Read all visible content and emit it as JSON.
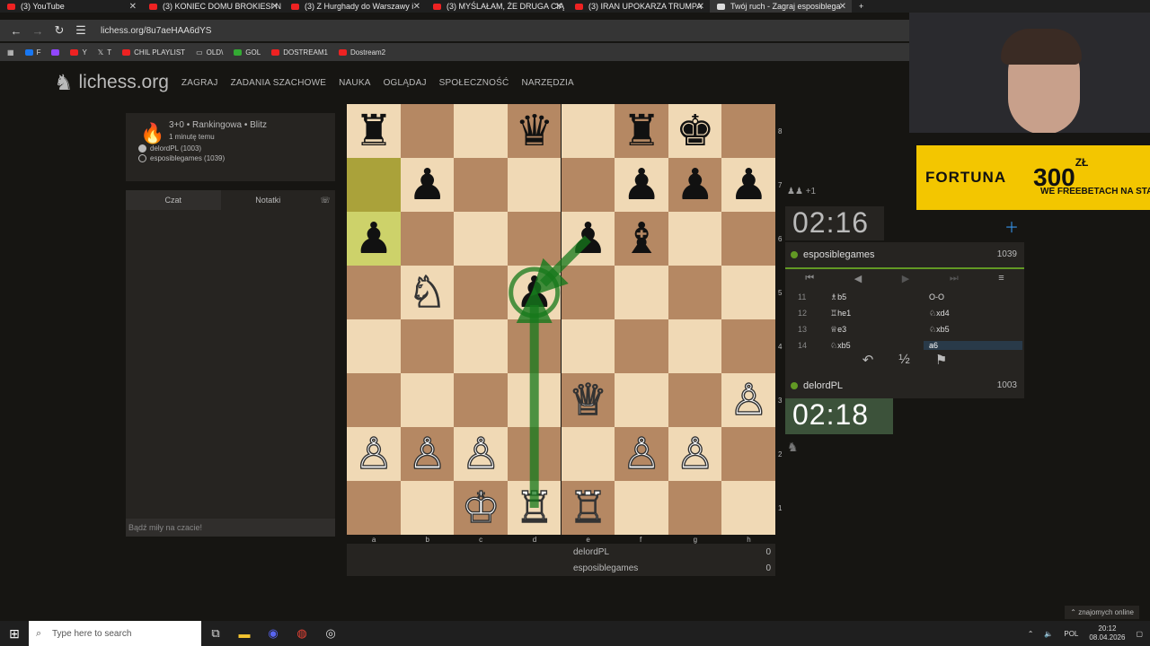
{
  "browser": {
    "tabs": [
      {
        "label": "(3) YouTube",
        "active": false
      },
      {
        "label": "(3) KONIEC DOMU BROKIESI N",
        "active": false
      },
      {
        "label": "(3) Z Hurghady do Warszawy i",
        "active": false
      },
      {
        "label": "(3) MYŚLAŁAM, ŻE DRUGA CIĄ",
        "active": false
      },
      {
        "label": "(3) IRAN UPOKARZA TRUMPA",
        "active": false
      },
      {
        "label": "Twój ruch - Zagraj esposiblega",
        "active": true
      }
    ],
    "url": "lichess.org/8u7aeHAA6dYS",
    "bookmarks": [
      "F",
      "Y",
      "T",
      "CHIL PLAYLIST",
      "OLD\\",
      "GOL",
      "DOSTREAM1",
      "Dostream2"
    ]
  },
  "lichess": {
    "logo": "lichess.org",
    "menu": [
      "ZAGRAJ",
      "ZADANIA SZACHOWE",
      "NAUKA",
      "OGLĄDAJ",
      "SPOŁECZNOŚĆ",
      "NARZĘDZIA"
    ]
  },
  "game_info": {
    "title": "3+0 • Rankingowa • Blitz",
    "time": "1 minutę temu",
    "white": "delordPL (1003)",
    "black": "esposiblegames (1039)"
  },
  "chat": {
    "tab_chat": "Czat",
    "tab_notes": "Notatki",
    "placeholder": "Bądź miły na czacie!"
  },
  "board": {
    "files": [
      "a",
      "b",
      "c",
      "d",
      "e",
      "f",
      "g",
      "h"
    ],
    "ranks": [
      "8",
      "7",
      "6",
      "5",
      "4",
      "3",
      "2",
      "1"
    ],
    "pieces": [
      {
        "sq": "a8",
        "p": "♜",
        "c": "b"
      },
      {
        "sq": "d8",
        "p": "♛",
        "c": "b"
      },
      {
        "sq": "f8",
        "p": "♜",
        "c": "b"
      },
      {
        "sq": "g8",
        "p": "♚",
        "c": "b"
      },
      {
        "sq": "b7",
        "p": "♟",
        "c": "b"
      },
      {
        "sq": "f7",
        "p": "♟",
        "c": "b"
      },
      {
        "sq": "g7",
        "p": "♟",
        "c": "b"
      },
      {
        "sq": "h7",
        "p": "♟",
        "c": "b"
      },
      {
        "sq": "a6",
        "p": "♟",
        "c": "b"
      },
      {
        "sq": "e6",
        "p": "♟",
        "c": "b"
      },
      {
        "sq": "f6",
        "p": "♝",
        "c": "b"
      },
      {
        "sq": "b5",
        "p": "♘",
        "c": "w"
      },
      {
        "sq": "d5",
        "p": "♟",
        "c": "b"
      },
      {
        "sq": "e3",
        "p": "♕",
        "c": "w"
      },
      {
        "sq": "h3",
        "p": "♙",
        "c": "w"
      },
      {
        "sq": "a2",
        "p": "♙",
        "c": "w"
      },
      {
        "sq": "b2",
        "p": "♙",
        "c": "w"
      },
      {
        "sq": "c2",
        "p": "♙",
        "c": "w"
      },
      {
        "sq": "f2",
        "p": "♙",
        "c": "w"
      },
      {
        "sq": "g2",
        "p": "♙",
        "c": "w"
      },
      {
        "sq": "c1",
        "p": "♔",
        "c": "w"
      },
      {
        "sq": "d1",
        "p": "♖",
        "c": "w"
      },
      {
        "sq": "e1",
        "p": "♖",
        "c": "w"
      }
    ],
    "last_move": [
      "a7",
      "a6"
    ],
    "arrows": [
      [
        "e6",
        "d5"
      ],
      [
        "d1",
        "d5"
      ]
    ]
  },
  "players_table": [
    {
      "name": "delordPL",
      "score": "0"
    },
    {
      "name": "esposiblegames",
      "score": "0"
    }
  ],
  "top_player": {
    "name": "esposiblegames",
    "rating": "1039",
    "clock": "02:16",
    "captured": "♟♟",
    "material": "+1"
  },
  "bottom_player": {
    "name": "delordPL",
    "rating": "1003",
    "clock": "02:18"
  },
  "moves": [
    {
      "n": "11",
      "w": "♗b5",
      "b": "O-O"
    },
    {
      "n": "12",
      "w": "♖he1",
      "b": "♘xd4"
    },
    {
      "n": "13",
      "w": "♕e3",
      "b": "♘xb5"
    },
    {
      "n": "14",
      "w": "♘xb5",
      "b": "a6"
    }
  ],
  "ad": {
    "brand": "FORTUNA",
    "amount": "300",
    "currency": "ZŁ",
    "sub": "WE FREEBETACH NA STAR"
  },
  "online": "znajomych online",
  "taskbar": {
    "search": "Type here to search",
    "lang": "POL",
    "time": "20:12",
    "date": "08.04.2026"
  }
}
